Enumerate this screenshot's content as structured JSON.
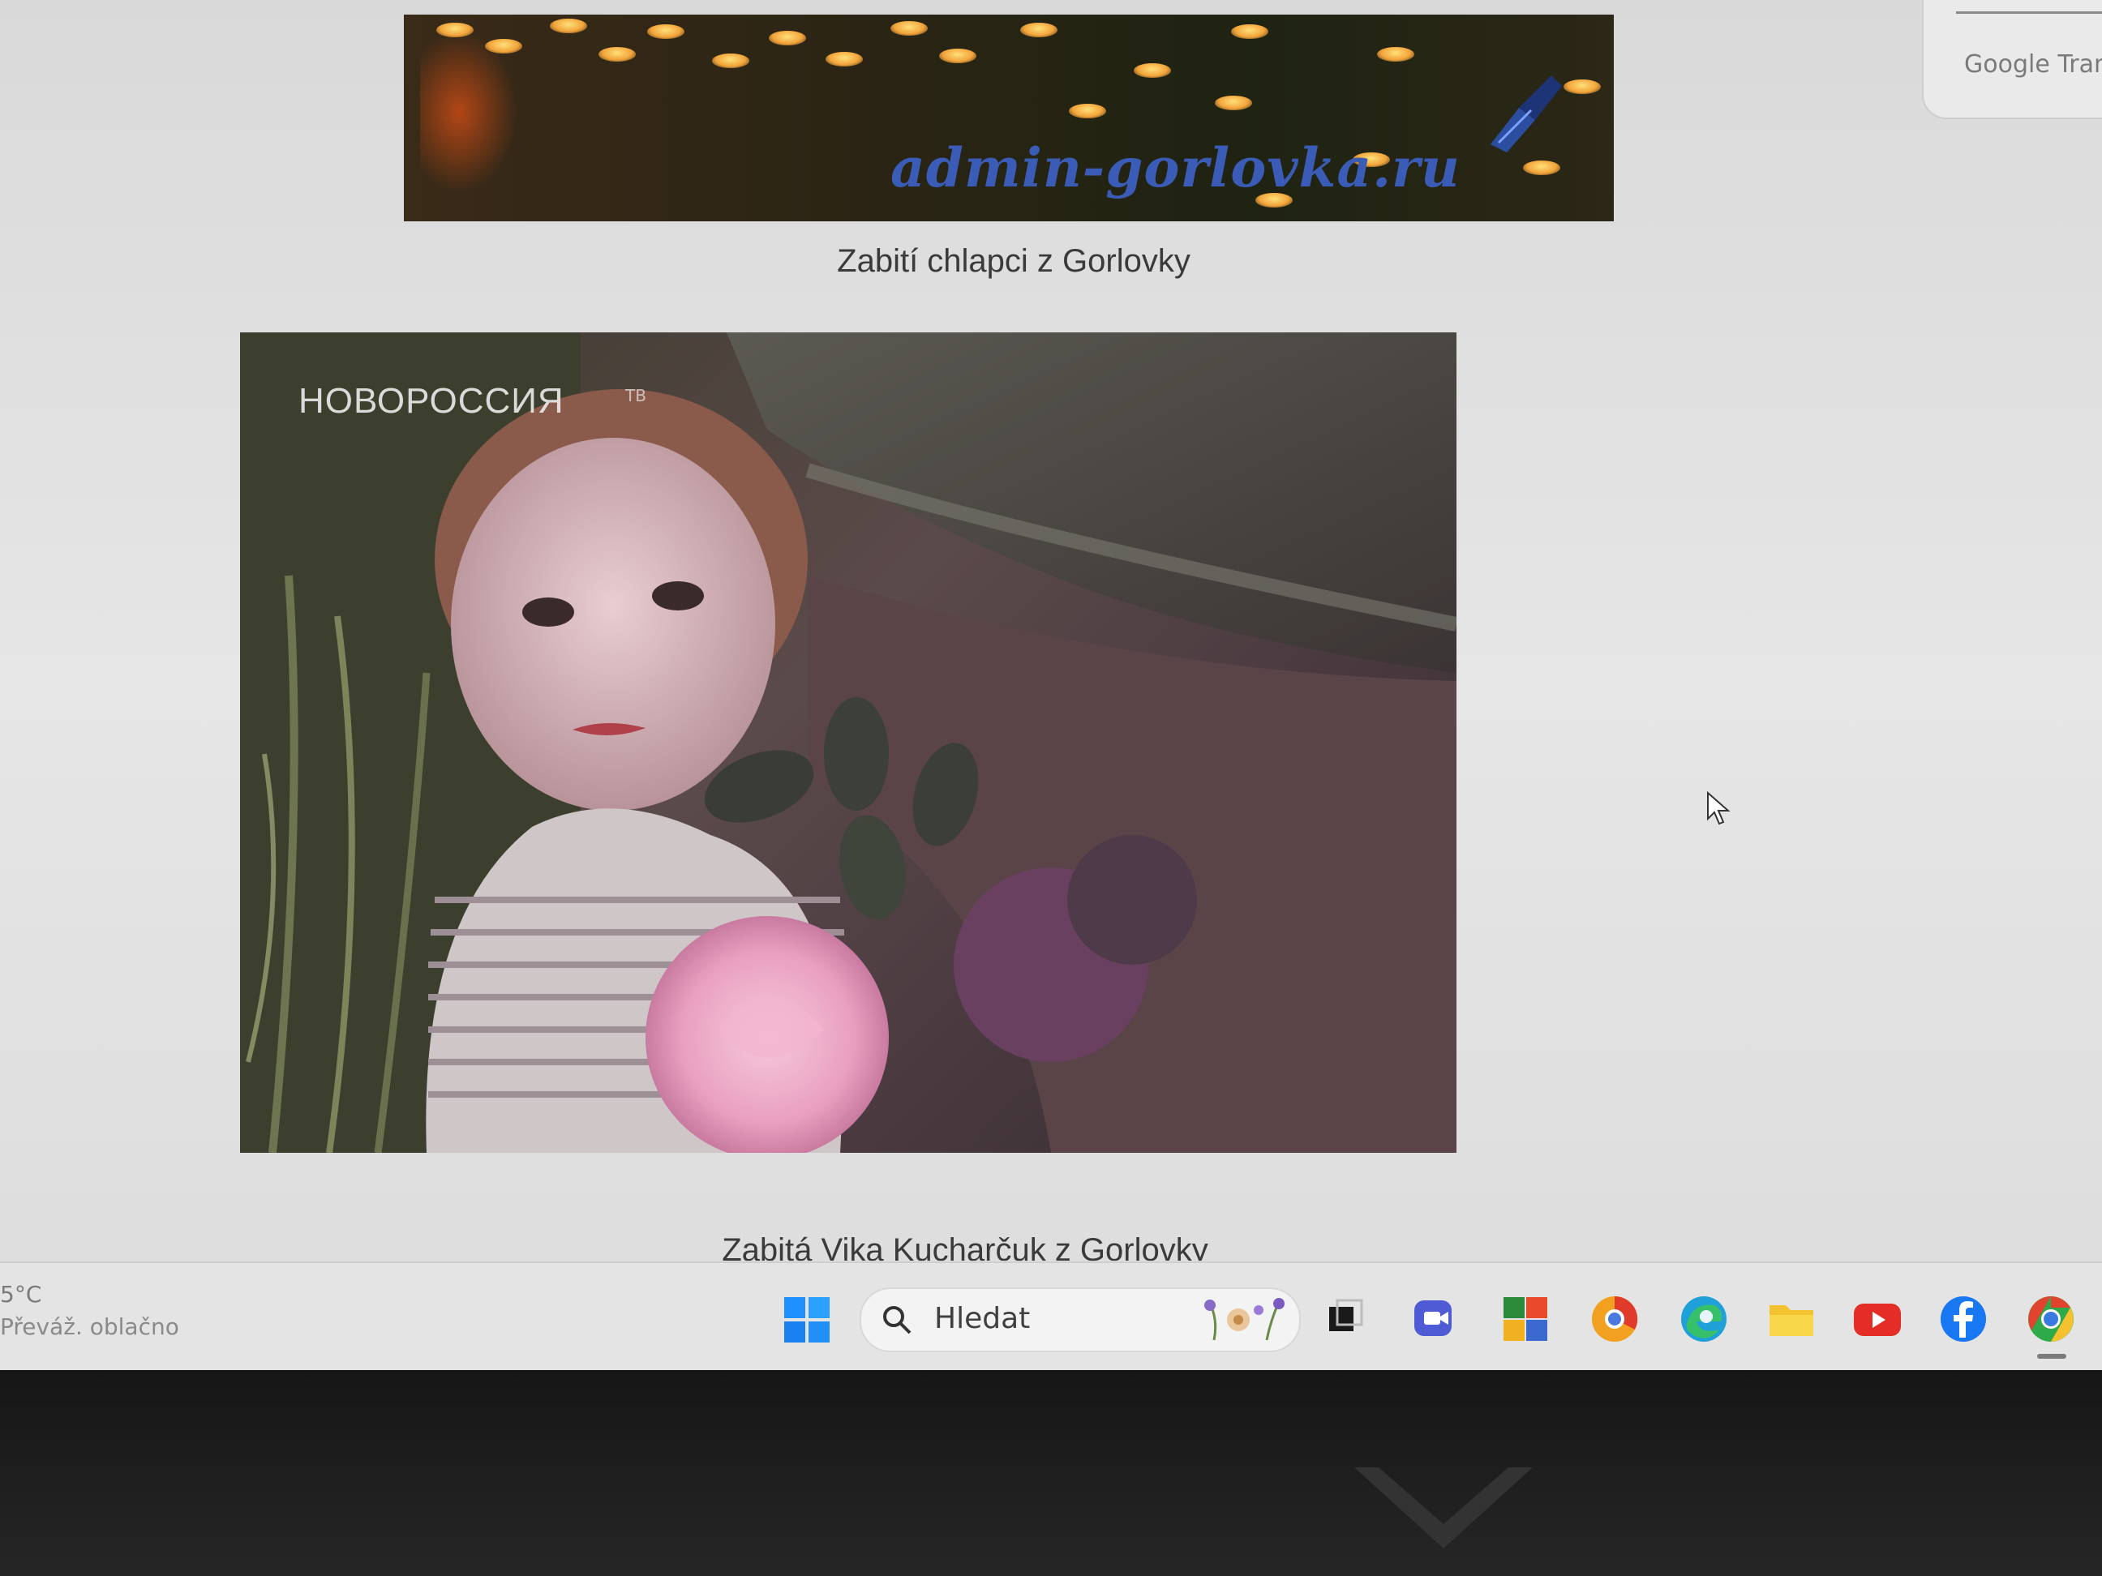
{
  "page": {
    "caption_1": "Zabití chlapci z Gorlovky",
    "caption_2": "Zabitá Vika Kucharčuk z Gorlovky"
  },
  "banner": {
    "watermark": "admin-gorlovka.ru"
  },
  "photo": {
    "watermark": "НОВОРОССИЯ",
    "watermark_sup": "ТВ"
  },
  "translate_panel": {
    "label": "Google Tran"
  },
  "taskbar": {
    "weather_temp": "5°C",
    "weather_desc": "Převáž. oblačno",
    "search_placeholder": "Hledat",
    "apps": [
      "task-view-icon",
      "teams-meet-icon",
      "photos-app-icon",
      "chrome-canary-icon",
      "edge-icon",
      "file-explorer-icon",
      "youtube-icon",
      "facebook-icon",
      "chrome-icon"
    ]
  },
  "colors": {
    "screen_bg": "#e2e2e2",
    "taskbar_bg": "#e4e4e4",
    "caption_text": "#3a3a3a",
    "banner_watermark": "#3b5cb6",
    "windows_blue": "#1e90ff",
    "youtube_red": "#e52d27",
    "facebook_blue": "#1877f2"
  }
}
